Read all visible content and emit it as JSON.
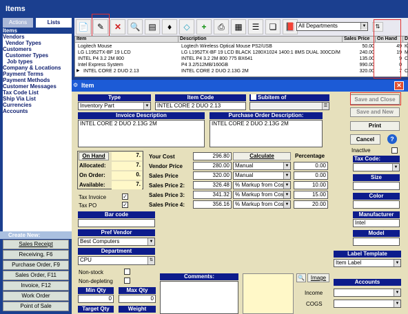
{
  "app": {
    "title": "Items"
  },
  "tabs": [
    "Actions",
    "Lists"
  ],
  "sidebar": {
    "items": [
      "Items",
      "Vendors",
      "Vendor Types",
      "Customers",
      "Customer Types",
      "Job types",
      "Company & Locations",
      "Payment Terms",
      "Payment Methods",
      "Customer Messages",
      "Tax Code List",
      "Ship Via List",
      "Currencies",
      "Accounts"
    ]
  },
  "create_new": {
    "title": "Create New:",
    "buttons": [
      "Sales Receipt",
      "Receiving, F6",
      "Purchase Order, F9",
      "Sales Order, F11",
      "Invoice, F12",
      "Work Order",
      "Point of Sale"
    ]
  },
  "toolbar": {
    "departments": "All Departments"
  },
  "grid": {
    "columns": [
      "Item",
      "Description",
      "Sales Price",
      "On Hand",
      "D"
    ],
    "rows": [
      {
        "item": "Logitech Mouse",
        "desc": "Logtech Wireless Optical Mouse PS2/USB",
        "price": "50.00",
        "onhand": "49",
        "d": "Ke"
      },
      {
        "item": "LG L1952TX-BF 19 LCD",
        "desc": "LG L1952TX-BF 19 LCD BLACK 1280X1024 1400:1 8MS DUAL 300CD/M",
        "price": "240.00",
        "onhand": "19",
        "d": "Mo"
      },
      {
        "item": "INTEL P4 3.2 2M 800",
        "desc": "INTEL P4 3.2 2M 800 775 BX641",
        "price": "135.00",
        "onhand": "9",
        "d": "CP"
      },
      {
        "item": "Intel Express System",
        "desc": "P4 3.2/512MB/160GB",
        "price": "990.00",
        "onhand": "0",
        "d": ""
      },
      {
        "item": "INTEL CORE 2 DUO 2.13",
        "desc": "INTEL CORE 2 DUO 2.13G 2M",
        "price": "320.00",
        "onhand": "7",
        "d": "CP"
      }
    ]
  },
  "dialog": {
    "title": "Item",
    "type_label": "Type",
    "type_value": "Inventory Part",
    "item_code_label": "Item Code",
    "item_code_value": "INTEL CORE 2 DUO 2.13",
    "subitem_label": "Subitem of",
    "invoice_desc_label": "Invoice Description",
    "invoice_desc_value": "INTEL CORE 2 DUO 2.13G 2M",
    "po_desc_label": "Purchase Order Description:",
    "po_desc_value": "INTEL CORE 2 DUO 2.13G 2M",
    "save_close": "Save and Close",
    "save_new": "Save and New",
    "print": "Print",
    "cancel": "Cancel",
    "inactive": "Inactive",
    "tax_code": "Tax Code:",
    "size": "Size",
    "color": "Color",
    "manufacturer": "Manufacturer",
    "manufacturer_value": "Intel",
    "model": "Model",
    "label_template": "Label Template",
    "label_template_value": "Item Label",
    "accounts": "Accounts",
    "income": "Income",
    "cogs": "COGS",
    "stock": [
      {
        "label": "On Hand",
        "value": "7."
      },
      {
        "label": "Allocated:",
        "value": "7."
      },
      {
        "label": "On Order:",
        "value": "0."
      },
      {
        "label": "Available:",
        "value": "7."
      }
    ],
    "your_cost_label": "Your Cost",
    "your_cost": "296.80",
    "calculate": "Calculate",
    "percentage": "Percentage",
    "prices": [
      {
        "label": "Vendor Price",
        "value": "280.00",
        "calc": "Manual",
        "pct": "0.00"
      },
      {
        "label": "Sales Price",
        "value": "320.00",
        "calc": "Manual",
        "pct": "0.00"
      },
      {
        "label": "Sales Price 2:",
        "value": "326.48",
        "calc": "% Markup from Cost",
        "pct": "10.00"
      },
      {
        "label": "Sales Price 3:",
        "value": "341.32",
        "calc": "% Markup from Cost",
        "pct": "15.00"
      },
      {
        "label": "Sales Price 4:",
        "value": "356.16",
        "calc": "% Markup from Cost",
        "pct": "20.00"
      }
    ],
    "tax_invoice": "Tax Invoice",
    "tax_po": "Tax PO",
    "barcode": "Bar code",
    "pref_vendor": "Pref Vendor",
    "pref_vendor_value": "Best Computers",
    "department": "Department",
    "department_value": "CPU",
    "non_stock": "Non-stock",
    "non_depleting": "Non-depleting",
    "comments": "Comments:",
    "image": "Image",
    "min_qty": "Min Qty",
    "min_qty_value": "0",
    "max_qty": "Max Qty",
    "max_qty_value": "0",
    "target_qty": "Target Qty",
    "weight": "Weight"
  }
}
